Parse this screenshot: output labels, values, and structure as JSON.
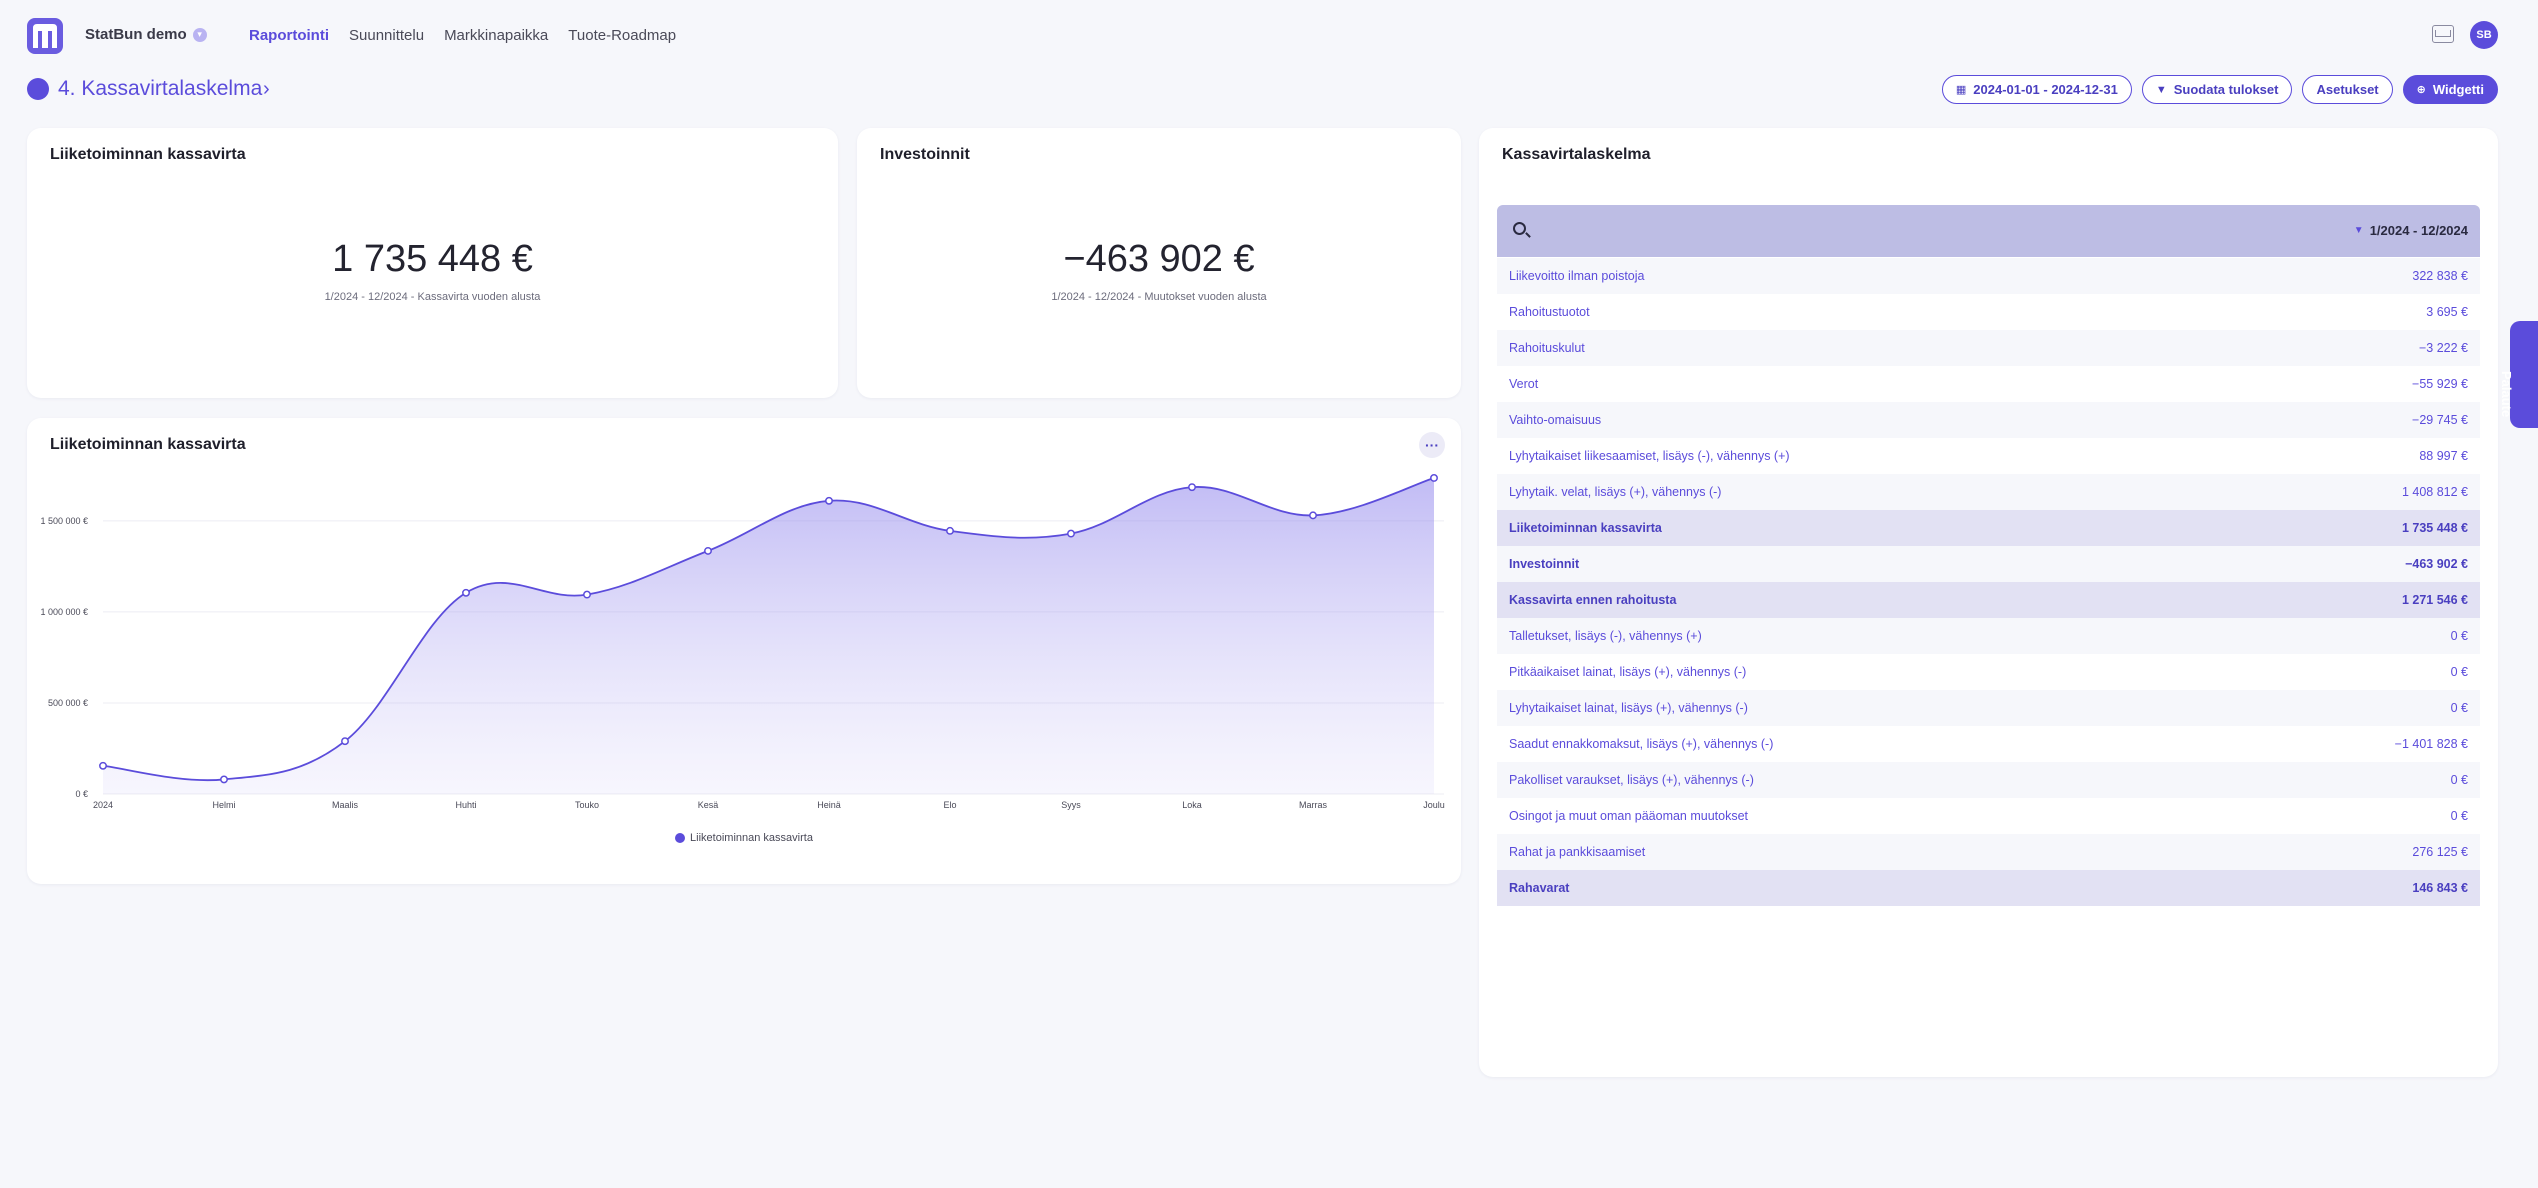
{
  "topbar": {
    "org_name": "StatBun demo",
    "user_initials": "SB",
    "nav": [
      {
        "label": "Raportointi",
        "active": true
      },
      {
        "label": "Suunnittelu",
        "active": false
      },
      {
        "label": "Markkinapaikka",
        "active": false
      },
      {
        "label": "Tuote-Roadmap",
        "active": false
      }
    ],
    "icons": {
      "inbox": "inbox-icon",
      "org_menu": "chevron-down-icon"
    }
  },
  "page": {
    "title": "4. Kassavirtalaskelma",
    "actions": {
      "date_range": "2024-01-01 - 2024-12-31",
      "filter": "Suodata tulokset",
      "settings": "Asetukset",
      "widget": "Widgetti"
    }
  },
  "kpi_operating": {
    "title": "Liiketoiminnan kassavirta",
    "value": "1 735 448 €",
    "subtitle": "1/2024 - 12/2024 - Kassavirta vuoden alusta"
  },
  "kpi_investments": {
    "title": "Investoinnit",
    "value": "−463 902 €",
    "subtitle": "1/2024 - 12/2024 - Muutokset vuoden alusta"
  },
  "chart_card": {
    "title": "Liiketoiminnan kassavirta",
    "more_label": "···"
  },
  "chart_data": {
    "type": "area",
    "x": [
      "2024",
      "Helmi",
      "Maalis",
      "Huhti",
      "Touko",
      "Kesä",
      "Heinä",
      "Elo",
      "Syys",
      "Loka",
      "Marras",
      "Joulu"
    ],
    "series": [
      {
        "name": "Liiketoiminnan kassavirta",
        "values": [
          155000,
          80000,
          290000,
          1105000,
          1095000,
          1335000,
          1610000,
          1445000,
          1430000,
          1685000,
          1530000,
          1735448
        ]
      }
    ],
    "yticks": [
      0,
      500000,
      1000000,
      1500000
    ],
    "ytick_labels": [
      "0 €",
      "500 000 €",
      "1 000 000 €",
      "1 500 000 €"
    ],
    "ylim": [
      0,
      1900000
    ],
    "grid": true,
    "legend_position": "bottom",
    "color": "#5b4cdb"
  },
  "statement": {
    "title": "Kassavirtalaskelma",
    "period": "1/2024 - 12/2024",
    "rows": [
      {
        "label": "Liikevoitto ilman poistoja",
        "value": "322 838 €",
        "style": "normal"
      },
      {
        "label": "Rahoitustuotot",
        "value": "3 695 €",
        "style": "normal"
      },
      {
        "label": "Rahoituskulut",
        "value": "−3 222 €",
        "style": "normal"
      },
      {
        "label": "Verot",
        "value": "−55 929 €",
        "style": "normal"
      },
      {
        "label": "Vaihto-omaisuus",
        "value": "−29 745 €",
        "style": "normal"
      },
      {
        "label": "Lyhytaikaiset liikesaamiset, lisäys (-), vähennys (+)",
        "value": "88 997 €",
        "style": "normal"
      },
      {
        "label": "Lyhytaik. velat, lisäys (+), vähennys (-)",
        "value": "1 408 812 €",
        "style": "normal"
      },
      {
        "label": "Liiketoiminnan kassavirta",
        "value": "1 735 448 €",
        "style": "sum"
      },
      {
        "label": "Investoinnit",
        "value": "−463 902 €",
        "style": "bold"
      },
      {
        "label": "Kassavirta ennen rahoitusta",
        "value": "1 271 546 €",
        "style": "sum"
      },
      {
        "label": "Talletukset, lisäys (-), vähennys (+)",
        "value": "0 €",
        "style": "normal"
      },
      {
        "label": "Pitkäaikaiset lainat, lisäys (+), vähennys (-)",
        "value": "0 €",
        "style": "normal"
      },
      {
        "label": "Lyhytaikaiset lainat, lisäys (+), vähennys (-)",
        "value": "0 €",
        "style": "normal"
      },
      {
        "label": "Saadut ennakkomaksut, lisäys (+), vähennys (-)",
        "value": "−1 401 828 €",
        "style": "normal"
      },
      {
        "label": "Pakolliset varaukset, lisäys (+), vähennys (-)",
        "value": "0 €",
        "style": "normal"
      },
      {
        "label": "Osingot ja muut oman pääoman muutokset",
        "value": "0 €",
        "style": "normal"
      },
      {
        "label": "Rahat ja pankkisaamiset",
        "value": "276 125 €",
        "style": "normal"
      },
      {
        "label": "Rahavarat",
        "value": "146 843 €",
        "style": "sum"
      }
    ]
  },
  "feedback": {
    "label": "Palaute"
  }
}
